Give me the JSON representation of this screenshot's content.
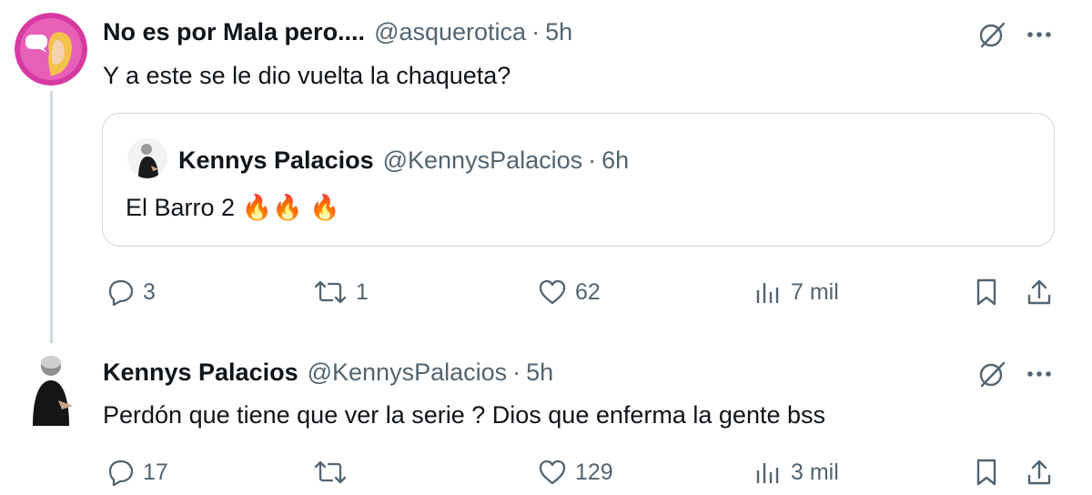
{
  "tweet1": {
    "name": "No es por Mala pero....",
    "handle": "@asquerotica",
    "separator": "·",
    "time": "5h",
    "text": "Y a este se le dio vuelta la chaqueta?",
    "quote": {
      "name": "Kennys Palacios",
      "handle": "@KennysPalacios",
      "separator": "·",
      "time": "6h",
      "text": "El Barro 2",
      "emoji": "🔥🔥 🔥"
    },
    "actions": {
      "replies": "3",
      "reposts": "1",
      "likes": "62",
      "views": "7 mil"
    }
  },
  "tweet2": {
    "name": "Kennys Palacios",
    "handle": "@KennysPalacios",
    "separator": "·",
    "time": "5h",
    "text": "Perdón que tiene que ver la serie ? Dios que enferma la gente bss",
    "actions": {
      "replies": "17",
      "reposts": "",
      "likes": "129",
      "views": "3 mil"
    }
  },
  "colors": {
    "text": "#0f1419",
    "secondary": "#536471",
    "border": "#cfd9de",
    "avatar_pink": "#d63aa0",
    "fire": "#f4900c"
  },
  "icons": [
    "grok-icon",
    "more-icon",
    "reply-icon",
    "repost-icon",
    "like-icon",
    "views-icon",
    "bookmark-icon",
    "share-icon"
  ]
}
